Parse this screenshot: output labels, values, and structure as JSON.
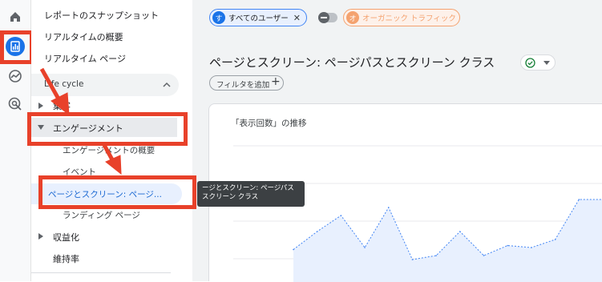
{
  "rail": {
    "icons": [
      "home-icon",
      "reports-icon",
      "explore-icon",
      "advertising-icon"
    ]
  },
  "sidebar": {
    "top_items": [
      "レポートのスナップショット",
      "リアルタイムの概要",
      "リアルタイム ページ"
    ],
    "section": {
      "label": "Life cycle"
    },
    "groups": {
      "acquisition": "集客",
      "engagement": "エンゲージメント",
      "monetization": "収益化",
      "retention": "維持率"
    },
    "engagement_children": [
      "エンゲージメントの概要",
      "イベント",
      "ページとスクリーン: ページ...",
      "ランディング ページ"
    ]
  },
  "tooltip": {
    "line1": "ージとスクリーン: ページパス",
    "line2": "スクリーン クラス"
  },
  "header": {
    "chip_user_avatar": "す",
    "chip_user_label": "すべてのユーザー",
    "chip_organic_avatar": "オ",
    "chip_organic_label": "オーガニック トラフィック",
    "title": "ページとスクリーン: ページパスとスクリーン クラス",
    "add_filter": "フィルタを追加"
  },
  "card": {
    "title": "「表示回数」の推移"
  },
  "chart_data": {
    "type": "area",
    "title": "「表示回数」の推移",
    "series": [
      {
        "values": [
          0.45,
          0.9,
          1.3,
          0.5,
          1.5,
          0.2,
          0.3,
          0.9,
          0.3,
          0.55,
          0.5,
          0.7,
          1.7,
          1.7
        ]
      }
    ]
  },
  "colors": {
    "accent": "#1a73e8",
    "annotation": "#e8412a",
    "highlight": "#e8f0fe",
    "organic": "#f4a26f"
  }
}
